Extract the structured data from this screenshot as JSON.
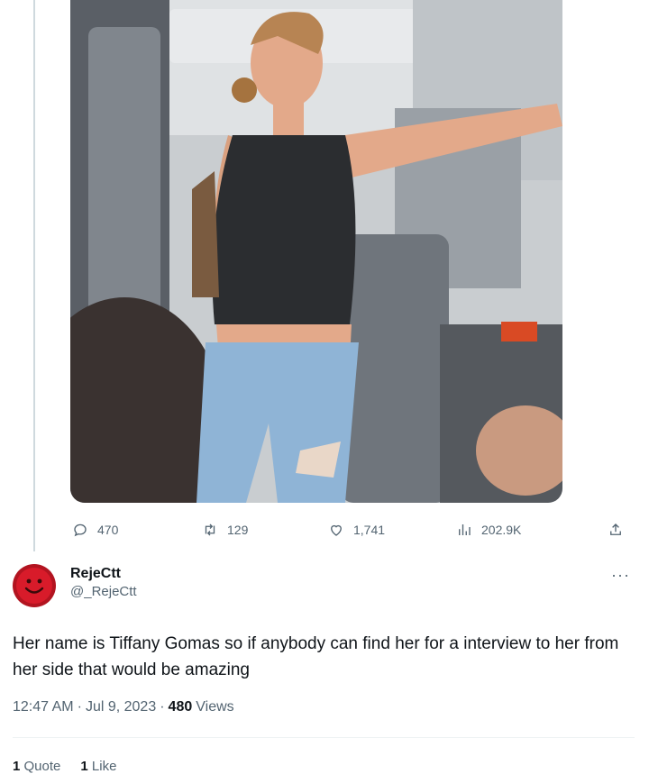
{
  "original_tweet": {
    "stats": {
      "replies": "470",
      "retweets": "129",
      "likes": "1,741",
      "views": "202.9K"
    },
    "icons": [
      "reply-icon",
      "retweet-icon",
      "like-icon",
      "views-icon",
      "share-icon"
    ]
  },
  "reply_tweet": {
    "display_name": "RejeCtt",
    "handle": "@_RejeCtt",
    "more_label": "···",
    "text": "Her name is Tiffany Gomas so if anybody can find her for a interview to her from her side that would be amazing",
    "time": "12:47 AM",
    "date": "Jul 9, 2023",
    "separator": "·",
    "views_count": "480",
    "views_label": "Views",
    "quotes_count": "1",
    "quotes_label": "Quote",
    "likes_count": "1",
    "likes_label": "Like"
  },
  "colors": {
    "text": "#0f1419",
    "secondary": "#536471",
    "avatar": "#b21420",
    "thread_line": "#cfd9de"
  }
}
